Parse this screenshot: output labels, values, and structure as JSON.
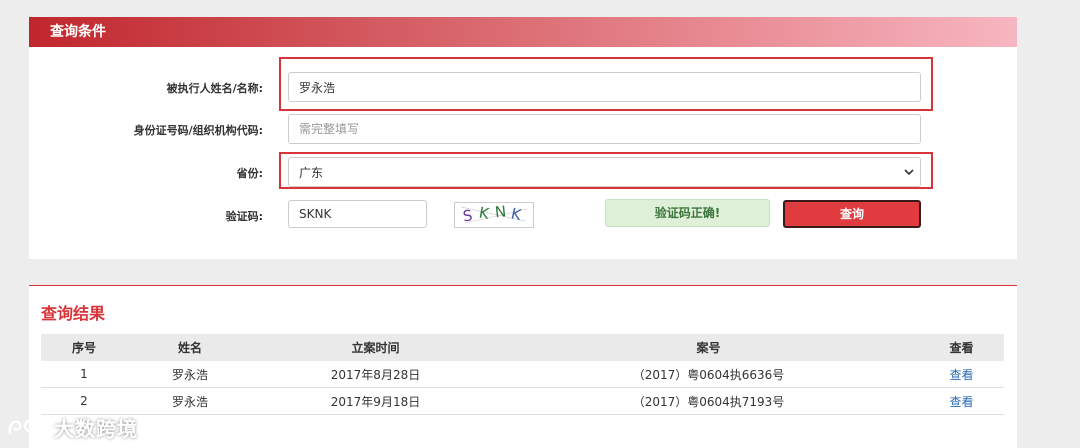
{
  "conditions": {
    "title": "查询条件",
    "name_label": "被执行人姓名/名称:",
    "name_value": "罗永浩",
    "id_label": "身份证号码/组织机构代码:",
    "id_placeholder": "需完整填写",
    "province_label": "省份:",
    "province_value": "广东",
    "captcha_label": "验证码:",
    "captcha_value": "SKNK",
    "captcha_image_text": "SKNK",
    "captcha_status": "验证码正确!",
    "query_button": "查询"
  },
  "results": {
    "title": "查询结果",
    "columns": [
      "序号",
      "姓名",
      "立案时间",
      "案号",
      "查看"
    ],
    "rows": [
      [
        "1",
        "罗永浩",
        "2017年8月28日",
        "（2017）粤0604执6636号",
        "查看"
      ],
      [
        "2",
        "罗永浩",
        "2017年9月18日",
        "（2017）粤0604执7193号",
        "查看"
      ]
    ]
  },
  "watermark": "大数跨境",
  "colors": {
    "accent_red": "#d9343a",
    "button_red": "#e03b3f",
    "success_bg": "#dff0d8",
    "link_blue": "#2a6bb5"
  }
}
